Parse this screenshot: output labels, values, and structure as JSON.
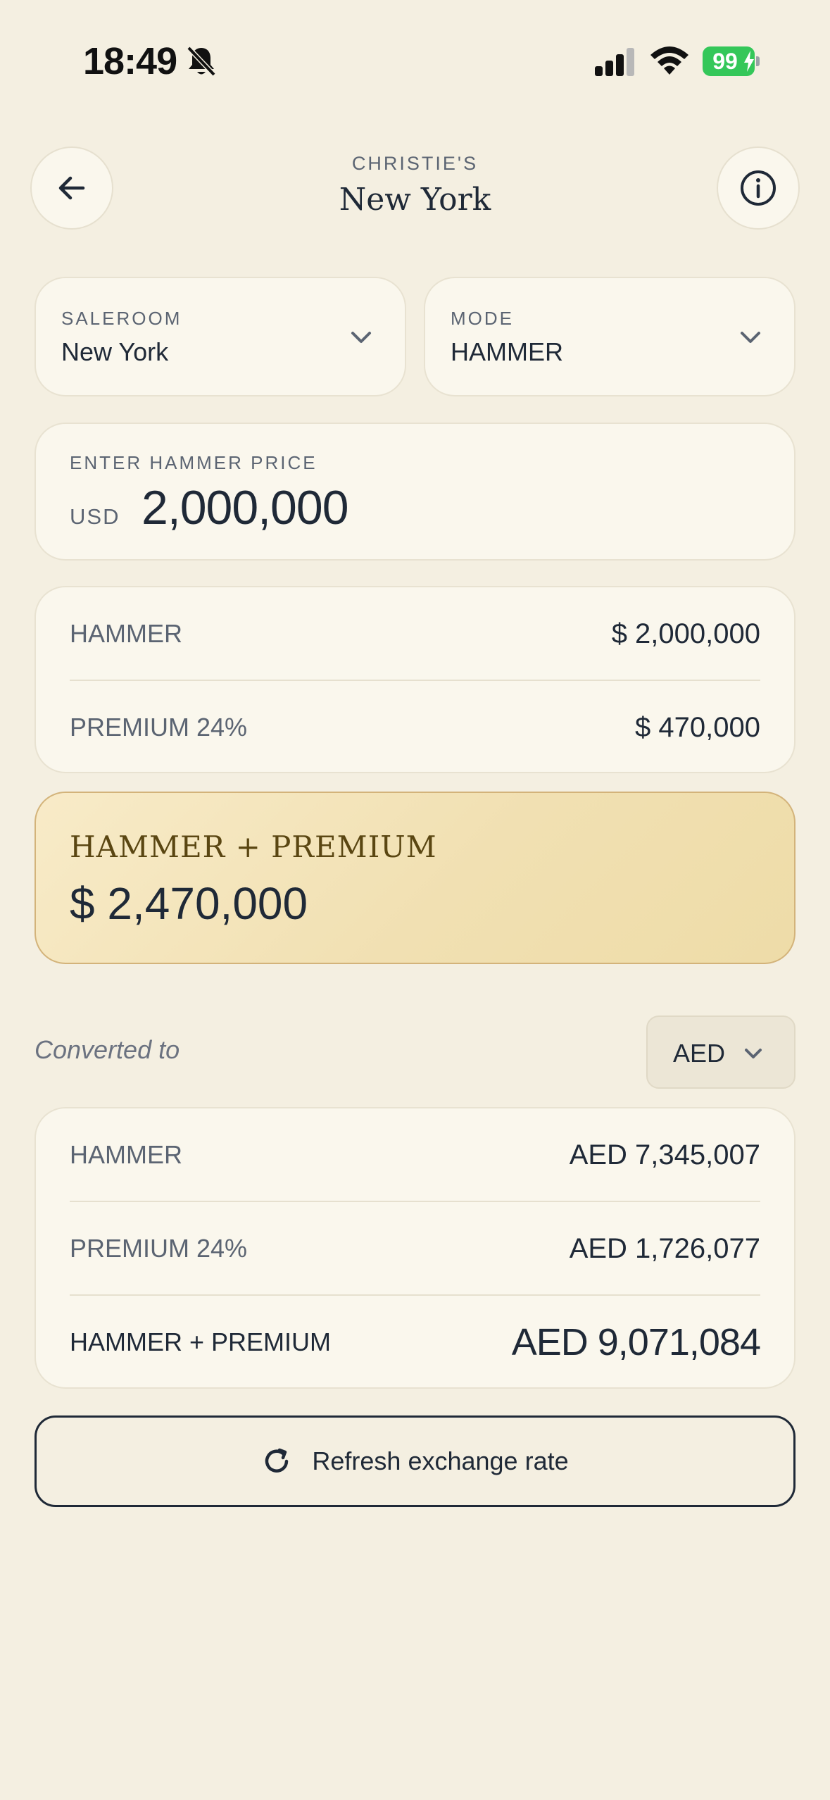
{
  "status_bar": {
    "time": "18:49",
    "battery": "99",
    "battery_color": "#34c759"
  },
  "header": {
    "subtitle": "CHRISTIE'S",
    "title": "New York"
  },
  "saleroom": {
    "label": "SALEROOM",
    "value": "New York"
  },
  "mode": {
    "label": "MODE",
    "value": "HAMMER"
  },
  "price_input": {
    "label": "ENTER HAMMER PRICE",
    "currency": "USD",
    "value": "2,000,000"
  },
  "breakdown": {
    "hammer_label": "HAMMER",
    "hammer_value": "$ 2,000,000",
    "premium_label": "PREMIUM 24%",
    "premium_value": "$ 470,000"
  },
  "total": {
    "label": "HAMMER + PREMIUM",
    "value": "$ 2,470,000",
    "accent_color": "#f1e0b2"
  },
  "conversion": {
    "label": "Converted to",
    "currency": "AED",
    "hammer_label": "HAMMER",
    "hammer_value": "AED 7,345,007",
    "premium_label": "PREMIUM 24%",
    "premium_value": "AED 1,726,077",
    "total_label": "HAMMER + PREMIUM",
    "total_value": "AED 9,071,084"
  },
  "refresh_button": {
    "label": "Refresh exchange rate"
  }
}
